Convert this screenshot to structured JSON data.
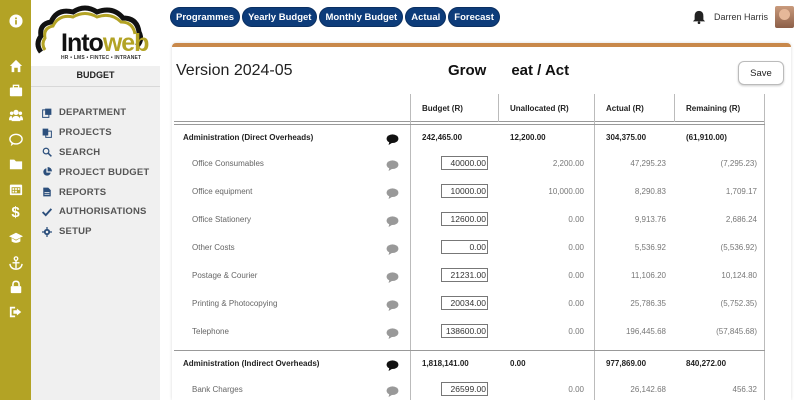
{
  "logo": {
    "text_a": "Into",
    "text_b": "web",
    "tagline": "HR • LMS • FINTEC • INTRANET"
  },
  "sidebar": {
    "section_label": "BUDGET",
    "items": [
      {
        "label": "DEPARTMENT",
        "icon": "department-icon"
      },
      {
        "label": "PROJECTS",
        "icon": "projects-icon"
      },
      {
        "label": "SEARCH",
        "icon": "search-icon"
      },
      {
        "label": "PROJECT BUDGET",
        "icon": "pie-chart-icon"
      },
      {
        "label": "REPORTS",
        "icon": "report-icon"
      },
      {
        "label": "AUTHORISATIONS",
        "icon": "check-icon"
      },
      {
        "label": "SETUP",
        "icon": "gear-icon"
      }
    ]
  },
  "rail_icons": [
    "info-icon",
    "home-icon",
    "briefcase-icon",
    "users-icon",
    "chat-icon",
    "folder-icon",
    "calendar-icon",
    "dollar-icon",
    "graduation-cap-icon",
    "anchor-icon",
    "lock-icon",
    "sign-out-icon"
  ],
  "topnav": [
    "Programmes",
    "Yearly Budget",
    "Monthly Budget",
    "Actual",
    "Forecast"
  ],
  "user": {
    "name": "Darren Harris"
  },
  "panel": {
    "version": "Version 2024-05",
    "title": "Grow      eat / Act",
    "save_label": "Save"
  },
  "table": {
    "headers": [
      "Budget (R)",
      "Unallocated (R)",
      "Actual (R)",
      "Remaining (R)"
    ],
    "rows": [
      {
        "type": "group",
        "label": "Administration (Direct Overheads)",
        "budget": "242,465.00",
        "unallocated": "12,200.00",
        "actual": "304,375.00",
        "remaining": "(61,910.00)"
      },
      {
        "type": "item",
        "label": "Office Consumables",
        "budget": "40000.00",
        "unallocated": "2,200.00",
        "actual": "47,295.23",
        "remaining": "(7,295.23)"
      },
      {
        "type": "item",
        "label": "Office equipment",
        "budget": "10000.00",
        "unallocated": "10,000.00",
        "actual": "8,290.83",
        "remaining": "1,709.17"
      },
      {
        "type": "item",
        "label": "Office Stationery",
        "budget": "12600.00",
        "unallocated": "0.00",
        "actual": "9,913.76",
        "remaining": "2,686.24"
      },
      {
        "type": "item",
        "label": "Other Costs",
        "budget": "0.00",
        "unallocated": "0.00",
        "actual": "5,536.92",
        "remaining": "(5,536.92)"
      },
      {
        "type": "item",
        "label": "Postage & Courier",
        "budget": "21231.00",
        "unallocated": "0.00",
        "actual": "11,106.20",
        "remaining": "10,124.80"
      },
      {
        "type": "item",
        "label": "Printing & Photocopying",
        "budget": "20034.00",
        "unallocated": "0.00",
        "actual": "25,786.35",
        "remaining": "(5,752.35)"
      },
      {
        "type": "item",
        "label": "Telephone",
        "budget": "138600.00",
        "unallocated": "0.00",
        "actual": "196,445.68",
        "remaining": "(57,845.68)"
      },
      {
        "type": "group",
        "label": "Administration (Indirect Overheads)",
        "budget": "1,818,141.00",
        "unallocated": "0.00",
        "actual": "977,869.00",
        "remaining": "840,272.00"
      },
      {
        "type": "item",
        "label": "Bank Charges",
        "budget": "26599.00",
        "unallocated": "0.00",
        "actual": "26,142.68",
        "remaining": "456.32"
      }
    ]
  },
  "colors": {
    "rail": "#b3a325",
    "nav": "#0d3c7a",
    "accent": "#c8884a"
  }
}
